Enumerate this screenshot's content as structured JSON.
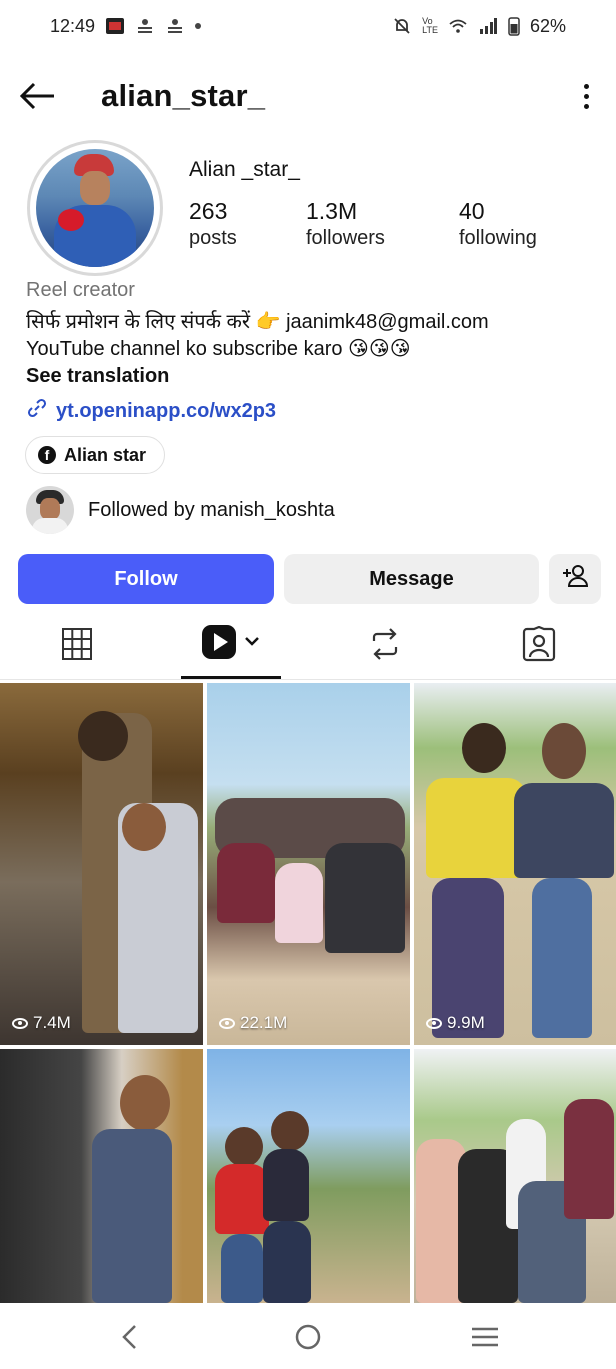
{
  "status_bar": {
    "time": "12:49",
    "battery": "62%",
    "icons": [
      "app-notification-icon",
      "news-icon",
      "news-icon",
      "dot-icon",
      "mute-icon",
      "volte-icon",
      "wifi-icon",
      "signal-icon",
      "battery-icon"
    ]
  },
  "header": {
    "username": "alian_star_",
    "back_icon": "back-arrow-icon",
    "more_icon": "more-vertical-icon"
  },
  "profile": {
    "display_name": "Alian _star_",
    "stats": {
      "posts": {
        "value": "263",
        "label": "posts"
      },
      "followers": {
        "value": "1.3M",
        "label": "followers"
      },
      "following": {
        "value": "40",
        "label": "following"
      }
    },
    "category": "Reel creator",
    "bio_line1": "सिर्फ प्रमोशन के लिए संपर्क करें 👉 jaanimk48@gmail.com",
    "bio_line2": "YouTube channel ko subscribe karo 😘😘😘",
    "see_translation": "See translation",
    "link": "yt.openinapp.co/wx2p3",
    "facebook_chip": "Alian star",
    "followed_by": "Followed by manish_koshta"
  },
  "actions": {
    "follow": "Follow",
    "message": "Message",
    "add_user_icon": "add-person-icon"
  },
  "tabs": [
    "grid-icon",
    "reels-icon",
    "reposts-icon",
    "tagged-icon"
  ],
  "grid": {
    "tiles": [
      {
        "views": "7.4M"
      },
      {
        "views": "22.1M"
      },
      {
        "views": "9.9M"
      },
      {
        "views": ""
      },
      {
        "views": ""
      },
      {
        "views": ""
      }
    ]
  },
  "nav": [
    "back-nav-icon",
    "home-nav-icon",
    "recents-nav-icon"
  ],
  "colors": {
    "follow_button": "#4a5df9",
    "link": "#2b4fc7",
    "secondary_button": "#efefef",
    "category_text": "#737373"
  }
}
